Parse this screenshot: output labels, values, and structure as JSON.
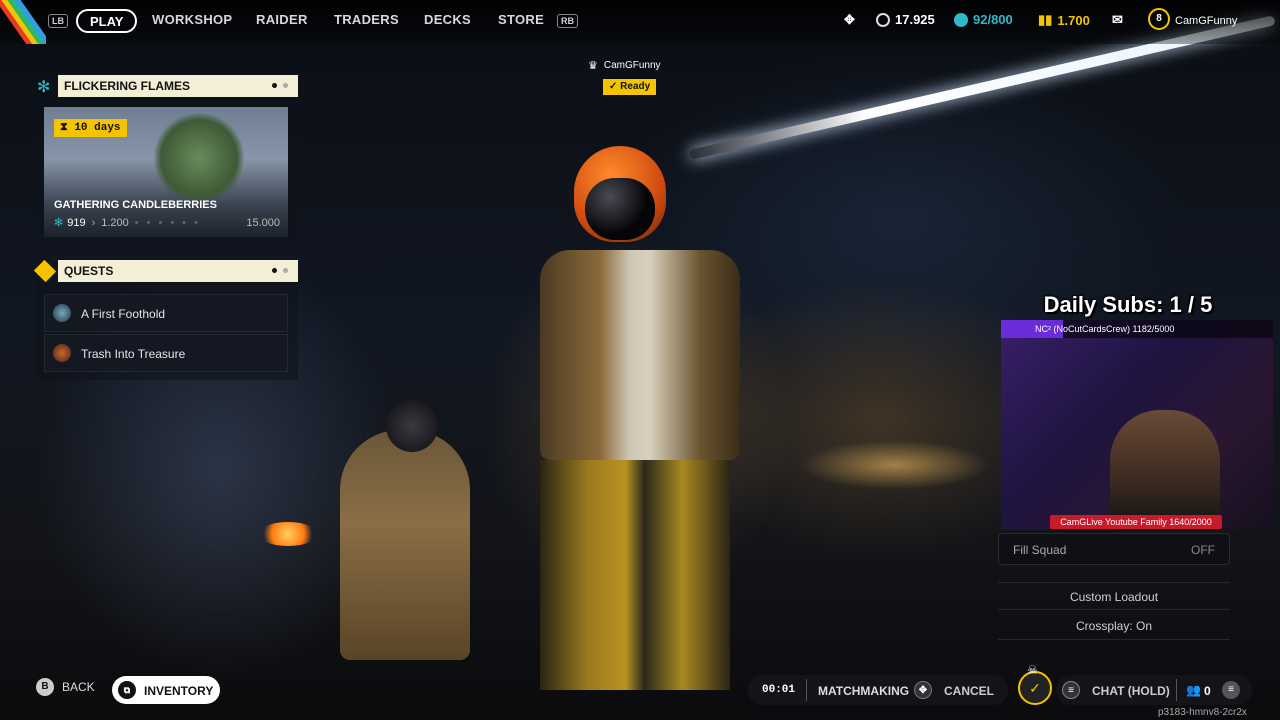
{
  "nav": {
    "lb": "LB",
    "rb": "RB",
    "items": [
      "PLAY",
      "WORKSHOP",
      "RAIDER",
      "TRADERS",
      "DECKS",
      "STORE"
    ],
    "active": "PLAY"
  },
  "currencies": {
    "coins": "17.925",
    "tokens": "92/800",
    "credits": "1.700"
  },
  "profile": {
    "level": "8",
    "name": "CamGFunny"
  },
  "lobby": {
    "player": "CamGFunny",
    "status": "Ready"
  },
  "event": {
    "title": "FLICKERING FLAMES",
    "timer": "10 days",
    "name": "GATHERING CANDLEBERRIES",
    "current": "919",
    "next": "1.200",
    "max": "15.000",
    "progress_fraction": 0.06
  },
  "quests": {
    "title": "QUESTS",
    "items": [
      "A First Foothold",
      "Trash Into Treasure"
    ]
  },
  "stream": {
    "daily_subs": "Daily Subs: 1 / 5",
    "top_banner": "NC² (NoCutCardsCrew) 1182/5000",
    "bottom_banner": "CamGLive Youtube Family 1640/2000"
  },
  "squad": {
    "fill_label": "Fill Squad",
    "fill_value": "OFF",
    "loadout": "Custom Loadout",
    "crossplay": "Crossplay: On"
  },
  "bottom": {
    "back_key": "B",
    "back": "BACK",
    "inventory": "INVENTORY",
    "timer": "00:01",
    "matchmaking": "MATCHMAKING",
    "cancel": "CANCEL",
    "chat": "CHAT (HOLD)",
    "party_count": "0",
    "session_id": "p3183-hmnv8-2cr2x"
  },
  "colors": {
    "accent_yellow": "#f5c400",
    "panel_header": "#f3eed6",
    "token_teal": "#2fb8c8"
  }
}
